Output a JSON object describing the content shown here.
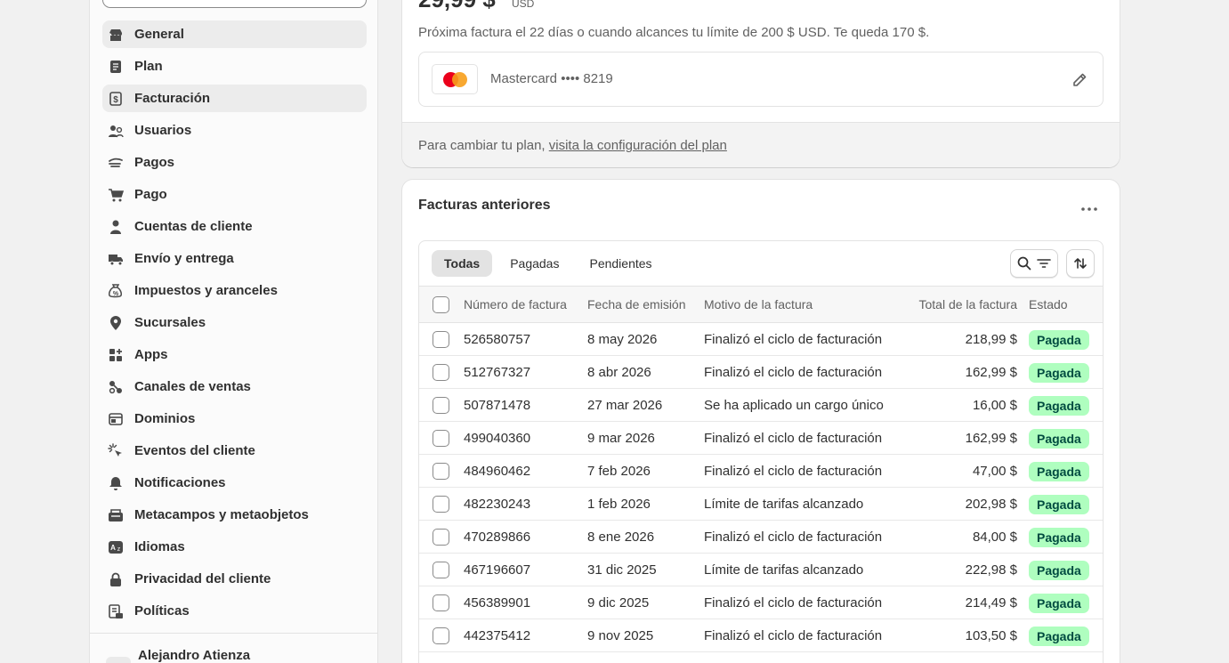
{
  "sidebar": {
    "items": [
      {
        "label": "General",
        "icon": "store-icon",
        "state": "hover"
      },
      {
        "label": "Plan",
        "icon": "plan-icon",
        "state": ""
      },
      {
        "label": "Facturación",
        "icon": "billing-icon",
        "state": "active"
      },
      {
        "label": "Usuarios",
        "icon": "users-icon",
        "state": ""
      },
      {
        "label": "Pagos",
        "icon": "payments-icon",
        "state": ""
      },
      {
        "label": "Pago",
        "icon": "cart-icon",
        "state": ""
      },
      {
        "label": "Cuentas de cliente",
        "icon": "person-icon",
        "state": ""
      },
      {
        "label": "Envío y entrega",
        "icon": "truck-icon",
        "state": ""
      },
      {
        "label": "Impuestos y aranceles",
        "icon": "tax-bag-icon",
        "state": ""
      },
      {
        "label": "Sucursales",
        "icon": "location-pin-icon",
        "state": ""
      },
      {
        "label": "Apps",
        "icon": "apps-icon",
        "state": ""
      },
      {
        "label": "Canales de ventas",
        "icon": "channels-icon",
        "state": ""
      },
      {
        "label": "Dominios",
        "icon": "domains-icon",
        "state": ""
      },
      {
        "label": "Eventos del cliente",
        "icon": "cursor-click-icon",
        "state": ""
      },
      {
        "label": "Notificaciones",
        "icon": "bell-icon",
        "state": ""
      },
      {
        "label": "Metacampos y metaobjetos",
        "icon": "metafields-icon",
        "state": ""
      },
      {
        "label": "Idiomas",
        "icon": "language-icon",
        "state": ""
      },
      {
        "label": "Privacidad del cliente",
        "icon": "lock-icon",
        "state": ""
      },
      {
        "label": "Políticas",
        "icon": "policies-icon",
        "state": ""
      }
    ],
    "user_name": "Alejandro Atienza"
  },
  "plan_card": {
    "price": "29,99 $",
    "currency": "USD",
    "next_invoice": "Próxima factura el 22 días o cuando alcances tu límite de 200 $ USD. Te queda 170 $.",
    "card_label": "Mastercard •••• 8219",
    "footer_prefix": "Para cambiar tu plan, ",
    "footer_link": "visita la configuración del plan"
  },
  "invoices": {
    "title": "Facturas anteriores",
    "tabs": [
      {
        "label": "Todas",
        "active": true
      },
      {
        "label": "Pagadas",
        "active": false
      },
      {
        "label": "Pendientes",
        "active": false
      }
    ],
    "headers": {
      "number": "Número de factura",
      "date": "Fecha de emisión",
      "reason": "Motivo de la factura",
      "total": "Total de la factura",
      "status": "Estado"
    },
    "status_color": "#affebf",
    "rows": [
      {
        "number": "526580757",
        "date": "8 may 2026",
        "reason": "Finalizó el ciclo de facturación",
        "total": "218,99 $",
        "status": "Pagada"
      },
      {
        "number": "512767327",
        "date": "8 abr 2026",
        "reason": "Finalizó el ciclo de facturación",
        "total": "162,99 $",
        "status": "Pagada"
      },
      {
        "number": "507871478",
        "date": "27 mar 2026",
        "reason": "Se ha aplicado un cargo único",
        "total": "16,00 $",
        "status": "Pagada"
      },
      {
        "number": "499040360",
        "date": "9 mar 2026",
        "reason": "Finalizó el ciclo de facturación",
        "total": "162,99 $",
        "status": "Pagada"
      },
      {
        "number": "484960462",
        "date": "7 feb 2026",
        "reason": "Finalizó el ciclo de facturación",
        "total": "47,00 $",
        "status": "Pagada"
      },
      {
        "number": "482230243",
        "date": "1 feb 2026",
        "reason": "Límite de tarifas alcanzado",
        "total": "202,98 $",
        "status": "Pagada"
      },
      {
        "number": "470289866",
        "date": "8 ene 2026",
        "reason": "Finalizó el ciclo de facturación",
        "total": "84,00 $",
        "status": "Pagada"
      },
      {
        "number": "467196607",
        "date": "31 dic 2025",
        "reason": "Límite de tarifas alcanzado",
        "total": "222,98 $",
        "status": "Pagada"
      },
      {
        "number": "456389901",
        "date": "9 dic 2025",
        "reason": "Finalizó el ciclo de facturación",
        "total": "214,49 $",
        "status": "Pagada"
      },
      {
        "number": "442375412",
        "date": "9 nov 2025",
        "reason": "Finalizó el ciclo de facturación",
        "total": "103,50 $",
        "status": "Pagada"
      }
    ]
  }
}
